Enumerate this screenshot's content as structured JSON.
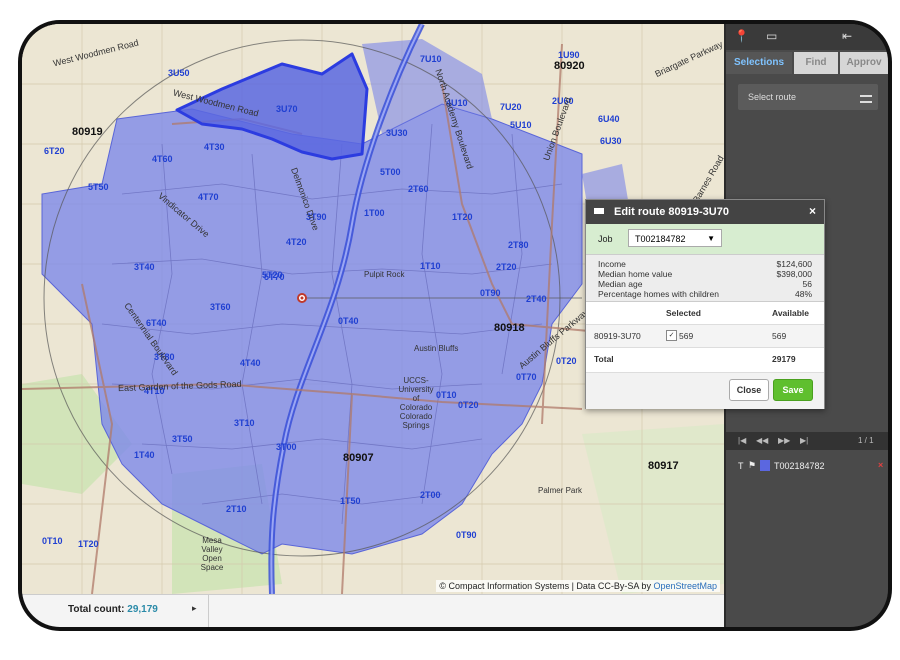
{
  "map": {
    "zip_labels": [
      "80920",
      "80919",
      "80918",
      "80907",
      "80917"
    ],
    "zone_labels": [
      "3U50",
      "3U70",
      "6T20",
      "4T60",
      "5T50",
      "4T70",
      "4T30",
      "3T90",
      "4T20",
      "3T40",
      "5T20",
      "3T60",
      "6T40",
      "3T80",
      "4T40",
      "4T10",
      "3T50",
      "3T10",
      "2T10",
      "1T20",
      "1T10",
      "1T40",
      "0T40",
      "1T50",
      "0T10",
      "7U10",
      "7U20",
      "1U90",
      "6U40",
      "3U30",
      "4U10",
      "5T00",
      "2T60",
      "1T20",
      "2T80",
      "0T10",
      "0T20",
      "1T00",
      "2T00",
      "2T40",
      "2T20",
      "0T90",
      "3T00",
      "0T70",
      "0T20",
      "5T70",
      "0T90",
      "5U10",
      "2U60",
      "6U30"
    ],
    "road_labels": [
      "West Woodmen Road",
      "West Woodmen Road",
      "Vindicator Drive",
      "Delmonico Drive",
      "Centennial Boulevard",
      "East Garden of the Gods Road",
      "North Academy Boulevard",
      "Austin Bluffs Parkway",
      "Union Boulevard",
      "Barnes Road",
      "Briargate Parkway"
    ],
    "place_labels": [
      "Pulpit Rock",
      "Austin Bluffs",
      "UCCS-University of Colorado Colorado Springs",
      "Mesa Valley Open Space",
      "Palmer Park"
    ],
    "attribution": "© Compact Information Systems | Data CC-By-SA by ",
    "attribution_link": "OpenStreetMap"
  },
  "statusbar": {
    "total_label": "Total count:",
    "total_value": "29,179",
    "chevron": "▸"
  },
  "sidebar": {
    "tabs": [
      {
        "label": "Selections",
        "active": true
      },
      {
        "label": "Find",
        "active": false
      },
      {
        "label": "Approv",
        "active": false
      }
    ],
    "select_route_placeholder": "Select route",
    "pager_text": "1 / 1",
    "route_item": "T002184782",
    "route_item_prefix": "T"
  },
  "popup": {
    "title": "Edit route 80919-3U70",
    "close_glyph": "×",
    "job_label": "Job",
    "job_value": "T002184782",
    "stats": [
      {
        "label": "Income",
        "value": "$124,600"
      },
      {
        "label": "Median home value",
        "value": "$398,000"
      },
      {
        "label": "Median age",
        "value": "56"
      },
      {
        "label": "Percentage homes with children",
        "value": "48%"
      }
    ],
    "table": {
      "col_selected": "Selected",
      "col_available": "Available",
      "row_route": "80919-3U70",
      "row_selected": "569",
      "row_available": "569",
      "total_label": "Total",
      "total_value": "29179"
    },
    "close_button": "Close",
    "save_button": "Save"
  },
  "colors": {
    "selection_fill": "#7b86ea",
    "selection_edge": "#3a4ed8",
    "highlight_route": "#2c3ce0",
    "save_green": "#5fbf2e",
    "tab_active_text": "#7fc3ff"
  }
}
